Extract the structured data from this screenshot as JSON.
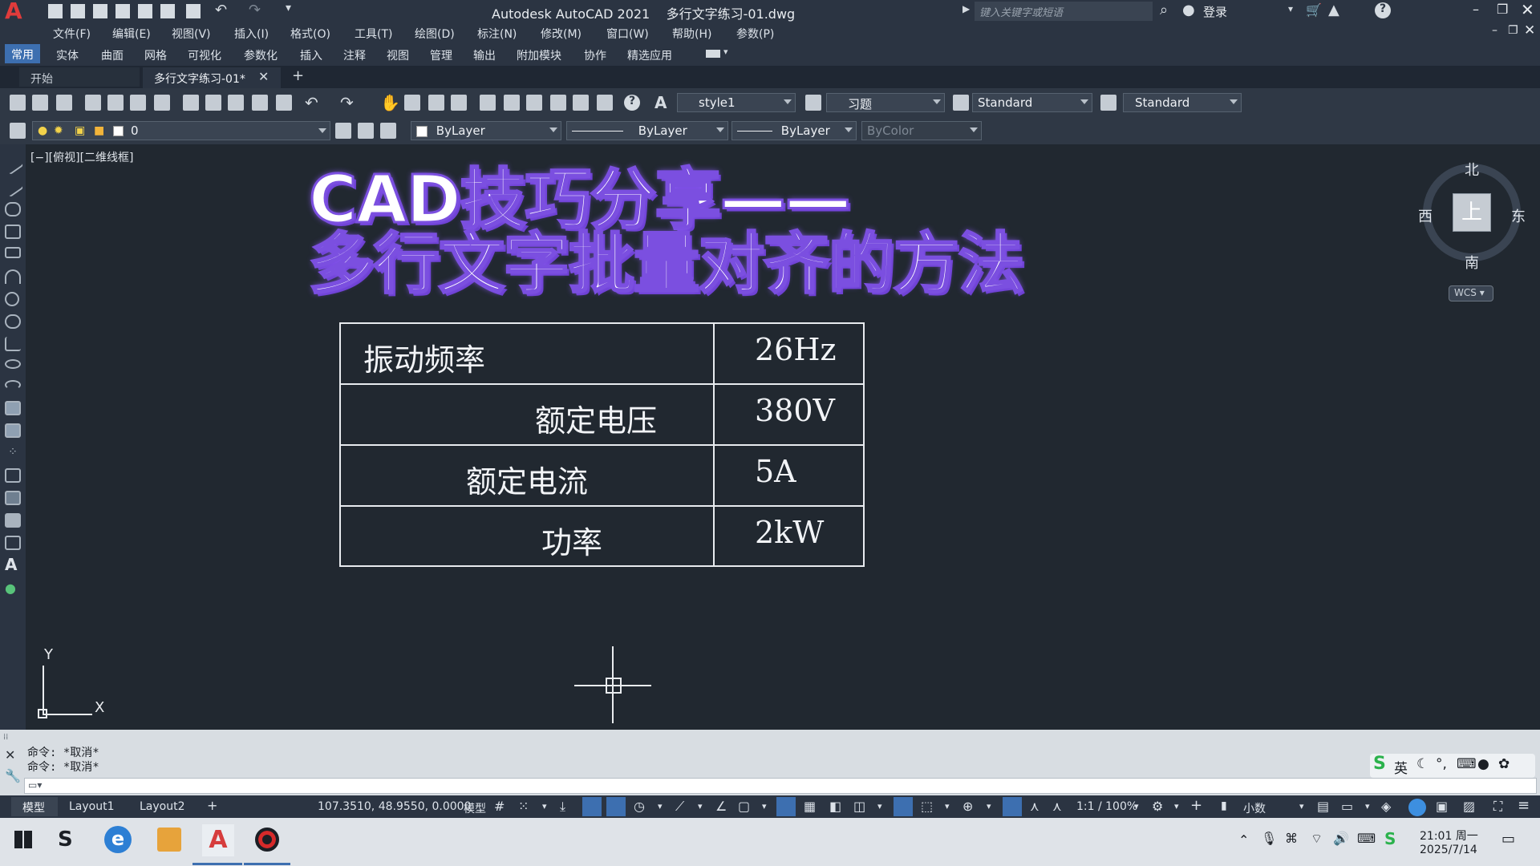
{
  "app": {
    "title": "Autodesk AutoCAD 2021    多行文字练习-01.dwg",
    "search_placeholder": "键入关键字或短语",
    "login_label": "登录",
    "logo_letter": "A"
  },
  "menu": [
    "文件(F)",
    "编辑(E)",
    "视图(V)",
    "插入(I)",
    "格式(O)",
    "工具(T)",
    "绘图(D)",
    "标注(N)",
    "修改(M)",
    "窗口(W)",
    "帮助(H)",
    "参数(P)"
  ],
  "ribbon_tabs": [
    "常用",
    "实体",
    "曲面",
    "网格",
    "可视化",
    "参数化",
    "插入",
    "注释",
    "视图",
    "管理",
    "输出",
    "附加模块",
    "协作",
    "精选应用"
  ],
  "doc_tabs": {
    "start": "开始",
    "active": "多行文字练习-01*"
  },
  "toolbar": {
    "text_style": "style1",
    "dim_style": "习题",
    "table_style": "Standard",
    "multileader_style": "Standard",
    "layer": "0",
    "color": "ByLayer",
    "linetype": "ByLayer",
    "lineweight": "ByLayer",
    "plotstyle": "ByColor"
  },
  "viewport_label": "[−][俯视][二维线框]",
  "overlay": {
    "line1": "CAD技巧分享——",
    "line2": "多行文字批量对齐的方法"
  },
  "table": {
    "rows": [
      {
        "label": "振动频率",
        "value": "26Hz"
      },
      {
        "label": "额定电压",
        "value": "380V"
      },
      {
        "label": "额定电流",
        "value": "5A"
      },
      {
        "label": "功率",
        "value": "2kW"
      }
    ]
  },
  "viewcube": {
    "north": "北",
    "south": "南",
    "east": "东",
    "west": "西",
    "top": "上",
    "wcs": "WCS"
  },
  "ucs": {
    "x": "X",
    "y": "Y"
  },
  "command": {
    "line1": "命令: *取消*",
    "line2": "命令: *取消*"
  },
  "ime": {
    "lang": "英"
  },
  "layout_tabs": [
    "模型",
    "Layout1",
    "Layout2"
  ],
  "status": {
    "coords": "107.3510, 48.9550, 0.0000",
    "space": "模型",
    "scale": "1:1 / 100%",
    "units": "小数"
  },
  "clock": {
    "time": "21:01 周一",
    "date": "2025/7/14"
  },
  "colors": {
    "accent": "#7b4fe0",
    "canvas": "#212830",
    "autocad_red": "#d63d3d"
  }
}
